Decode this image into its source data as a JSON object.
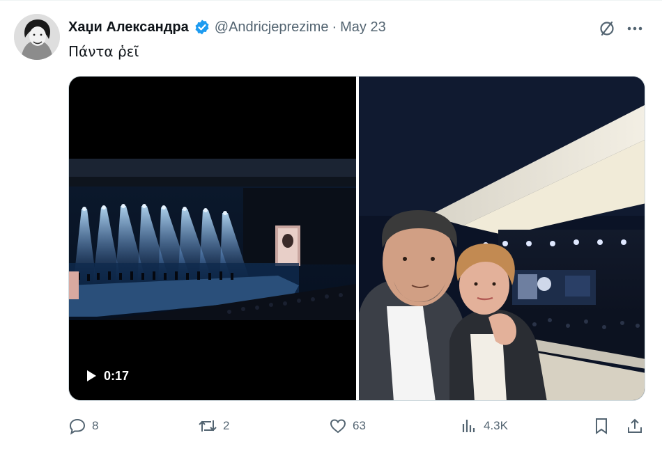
{
  "post": {
    "display_name": "Хаџи Александра",
    "handle": "@Andricjeprezime",
    "separator": "·",
    "date": "May 23",
    "text": "Πάντα ῥεῖ"
  },
  "media": {
    "video_duration": "0:17"
  },
  "actions": {
    "replies": "8",
    "reposts": "2",
    "likes": "63",
    "views": "4.3K"
  },
  "icons": [
    "avatar-image",
    "verified-badge-icon",
    "grok-icon",
    "more-icon",
    "play-icon",
    "reply-icon",
    "repost-icon",
    "like-icon",
    "views-icon",
    "bookmark-icon",
    "share-icon"
  ],
  "colors": {
    "verified": "#1d9bf0",
    "text_primary": "#0f1419",
    "text_secondary": "#536471"
  }
}
